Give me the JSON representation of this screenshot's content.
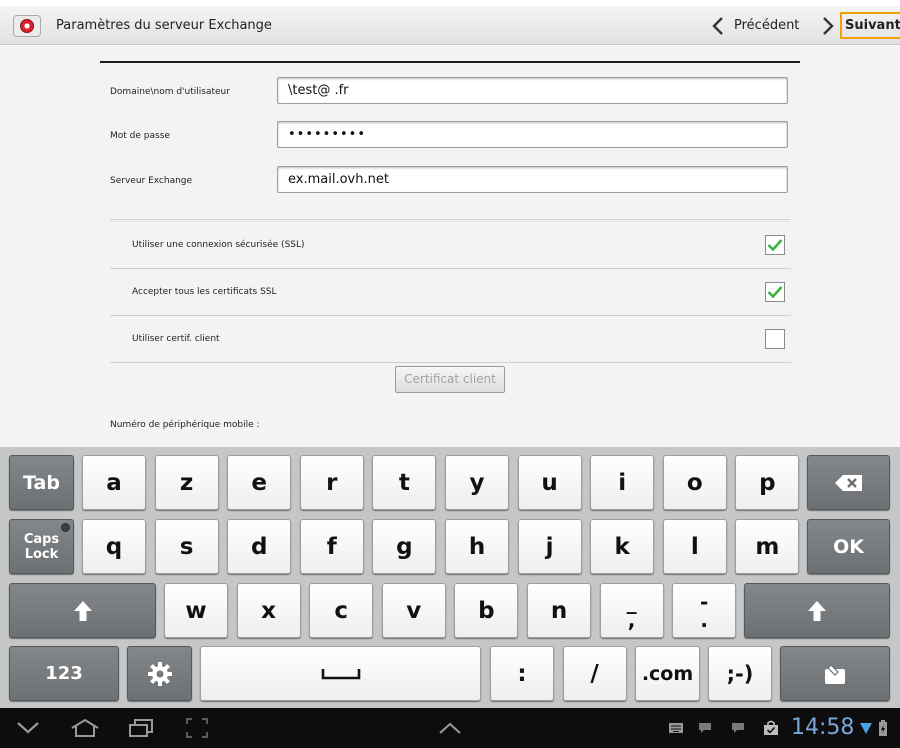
{
  "appbar": {
    "title": "Paramètres du serveur Exchange",
    "prev_label": "Précédent",
    "next_label": "Suivant",
    "accent_color": "#f2a100"
  },
  "form": {
    "domain_label": "Domaine\\nom d'utilisateur",
    "domain_value": "\\test@             .fr",
    "password_label": "Mot de passe",
    "password_value": "•••••••••",
    "server_label": "Serveur Exchange",
    "server_value": "ex.mail.ovh.net"
  },
  "options": [
    {
      "label": "Utiliser une connexion sécurisée (SSL)",
      "checked": true
    },
    {
      "label": "Accepter tous les certificats SSL",
      "checked": true
    },
    {
      "label": "Utiliser certif. client",
      "checked": false
    }
  ],
  "client_cert_button": "Certificat client",
  "device_label": "Numéro de périphérique mobile :",
  "keyboard": {
    "tab": "Tab",
    "caps_line1": "Caps",
    "caps_line2": "Lock",
    "ok": "OK",
    "num": "123",
    "com": ".com",
    "smiley": ";-)",
    "row1": [
      "a",
      "z",
      "e",
      "r",
      "t",
      "y",
      "u",
      "i",
      "o",
      "p"
    ],
    "row2": [
      "q",
      "s",
      "d",
      "f",
      "g",
      "h",
      "j",
      "k",
      "l",
      "m"
    ],
    "row3": [
      "w",
      "x",
      "c",
      "v",
      "b",
      "n"
    ],
    "row3_dual": [
      {
        "top": "_",
        "bottom": ","
      },
      {
        "top": "-",
        "bottom": "."
      }
    ],
    "row4": [
      ":",
      "/"
    ]
  },
  "statusbar": {
    "time": "14:58",
    "clock_color": "#7aa7d8"
  }
}
